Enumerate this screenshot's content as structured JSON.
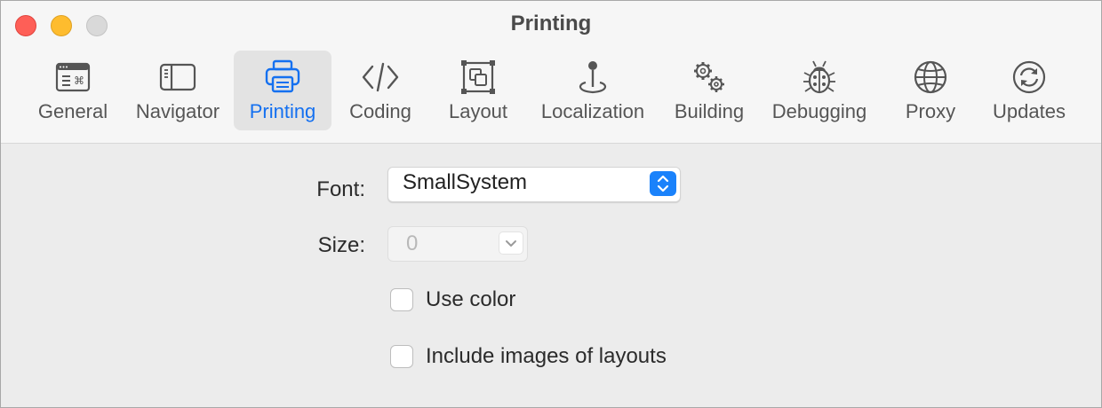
{
  "window": {
    "title": "Printing"
  },
  "toolbar": {
    "tabs": [
      {
        "label": "General",
        "icon": "general-window-icon",
        "active": false
      },
      {
        "label": "Navigator",
        "icon": "sidebar-icon",
        "active": false
      },
      {
        "label": "Printing",
        "icon": "printer-icon",
        "active": true
      },
      {
        "label": "Coding",
        "icon": "code-brackets-icon",
        "active": false
      },
      {
        "label": "Layout",
        "icon": "layout-frame-icon",
        "active": false
      },
      {
        "label": "Localization",
        "icon": "joystick-pin-icon",
        "active": false
      },
      {
        "label": "Building",
        "icon": "gears-icon",
        "active": false
      },
      {
        "label": "Debugging",
        "icon": "ladybug-icon",
        "active": false
      },
      {
        "label": "Proxy",
        "icon": "globe-icon",
        "active": false
      },
      {
        "label": "Updates",
        "icon": "refresh-icon",
        "active": false
      }
    ]
  },
  "form": {
    "font_label": "Font:",
    "font_value": "SmallSystem",
    "size_label": "Size:",
    "size_value": "0",
    "use_color_label": "Use color",
    "use_color_checked": false,
    "include_images_label": "Include images of layouts",
    "include_images_checked": false
  },
  "colors": {
    "accent": "#1470f0",
    "close": "#fe5f57",
    "minimize": "#febc2e",
    "zoom": "#d9d9d9"
  }
}
